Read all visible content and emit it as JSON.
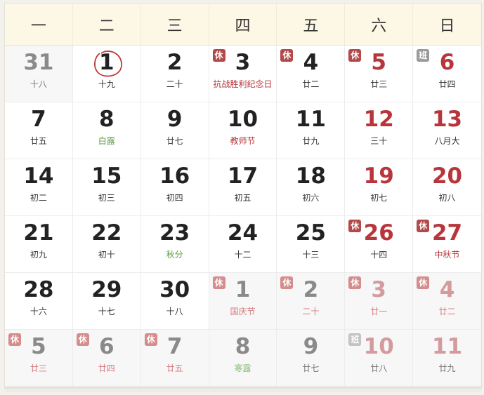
{
  "weekdays": [
    "一",
    "二",
    "三",
    "四",
    "五",
    "六",
    "日"
  ],
  "days": [
    {
      "day": "31",
      "sub": "十八",
      "other": true
    },
    {
      "day": "1",
      "sub": "十九",
      "today": true
    },
    {
      "day": "2",
      "sub": "二十"
    },
    {
      "day": "3",
      "sub": "抗战胜利纪念日",
      "badge": "休",
      "fest": true
    },
    {
      "day": "4",
      "sub": "廿二",
      "badge": "休"
    },
    {
      "day": "5",
      "sub": "廿三",
      "badge": "休",
      "red": true
    },
    {
      "day": "6",
      "sub": "廿四",
      "badge": "班",
      "red": true
    },
    {
      "day": "7",
      "sub": "廿五"
    },
    {
      "day": "8",
      "sub": "白露",
      "term": true
    },
    {
      "day": "9",
      "sub": "廿七"
    },
    {
      "day": "10",
      "sub": "教师节",
      "fest": true
    },
    {
      "day": "11",
      "sub": "廿九"
    },
    {
      "day": "12",
      "sub": "三十",
      "red": true
    },
    {
      "day": "13",
      "sub": "八月大",
      "red": true
    },
    {
      "day": "14",
      "sub": "初二"
    },
    {
      "day": "15",
      "sub": "初三"
    },
    {
      "day": "16",
      "sub": "初四"
    },
    {
      "day": "17",
      "sub": "初五"
    },
    {
      "day": "18",
      "sub": "初六"
    },
    {
      "day": "19",
      "sub": "初七",
      "red": true
    },
    {
      "day": "20",
      "sub": "初八",
      "red": true
    },
    {
      "day": "21",
      "sub": "初九"
    },
    {
      "day": "22",
      "sub": "初十"
    },
    {
      "day": "23",
      "sub": "秋分",
      "term": true
    },
    {
      "day": "24",
      "sub": "十二"
    },
    {
      "day": "25",
      "sub": "十三"
    },
    {
      "day": "26",
      "sub": "十四",
      "badge": "休",
      "red": true
    },
    {
      "day": "27",
      "sub": "中秋节",
      "badge": "休",
      "red": true,
      "fest": true
    },
    {
      "day": "28",
      "sub": "十六"
    },
    {
      "day": "29",
      "sub": "十七"
    },
    {
      "day": "30",
      "sub": "十八"
    },
    {
      "day": "1",
      "sub": "国庆节",
      "badge": "休",
      "other": true,
      "fest": true
    },
    {
      "day": "2",
      "sub": "二十",
      "badge": "休",
      "other": true,
      "fest": true
    },
    {
      "day": "3",
      "sub": "廿一",
      "badge": "休",
      "other": true,
      "red": true,
      "fest": true
    },
    {
      "day": "4",
      "sub": "廿二",
      "badge": "休",
      "other": true,
      "red": true,
      "fest": true
    },
    {
      "day": "5",
      "sub": "廿三",
      "badge": "休",
      "other": true,
      "fest": true
    },
    {
      "day": "6",
      "sub": "廿四",
      "badge": "休",
      "other": true,
      "fest": true
    },
    {
      "day": "7",
      "sub": "廿五",
      "badge": "休",
      "other": true,
      "fest": true
    },
    {
      "day": "8",
      "sub": "寒露",
      "other": true,
      "term": true
    },
    {
      "day": "9",
      "sub": "廿七",
      "other": true
    },
    {
      "day": "10",
      "sub": "廿八",
      "badge": "班",
      "other": true,
      "red": true
    },
    {
      "day": "11",
      "sub": "廿九",
      "other": true,
      "red": true
    }
  ]
}
